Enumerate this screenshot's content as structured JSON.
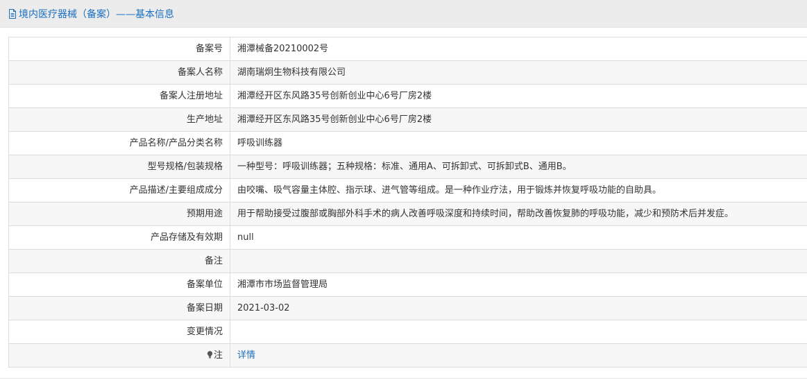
{
  "header": {
    "title": "境内医疗器械（备案）——基本信息",
    "accent_color": "#1a6fc0",
    "icon": "document-icon"
  },
  "rows": [
    {
      "label": "备案号",
      "value": "湘潭械备20210002号"
    },
    {
      "label": "备案人名称",
      "value": "湖南瑞炯生物科技有限公司"
    },
    {
      "label": "备案人注册地址",
      "value": "湘潭经开区东风路35号创新创业中心6号厂房2楼"
    },
    {
      "label": "生产地址",
      "value": "湘潭经开区东风路35号创新创业中心6号厂房2楼"
    },
    {
      "label": "产品名称/产品分类名称",
      "value": "呼吸训练器"
    },
    {
      "label": "型号规格/包装规格",
      "value": "一种型号：呼吸训练器；五种规格：标准、通用A、可拆卸式、可拆卸式B、通用B。"
    },
    {
      "label": "产品描述/主要组成成分",
      "value": "由咬嘴、吸气容量主体腔、指示球、进气管等组成。是一种作业疗法，用于锻炼并恢复呼吸功能的自助具。"
    },
    {
      "label": "预期用途",
      "value": "用于帮助接受过腹部或胸部外科手术的病人改善呼吸深度和持续时间，帮助改善恢复肺的呼吸功能，减少和预防术后并发症。"
    },
    {
      "label": "产品存储及有效期",
      "value": "null"
    },
    {
      "label": "备注",
      "value": ""
    },
    {
      "label": "备案单位",
      "value": "湘潭市市场监督管理局"
    },
    {
      "label": "备案日期",
      "value": "2021-03-02"
    },
    {
      "label": "变更情况",
      "value": ""
    }
  ],
  "note_row": {
    "label": "注",
    "link_text": "详情",
    "icon": "lightbulb-icon"
  }
}
